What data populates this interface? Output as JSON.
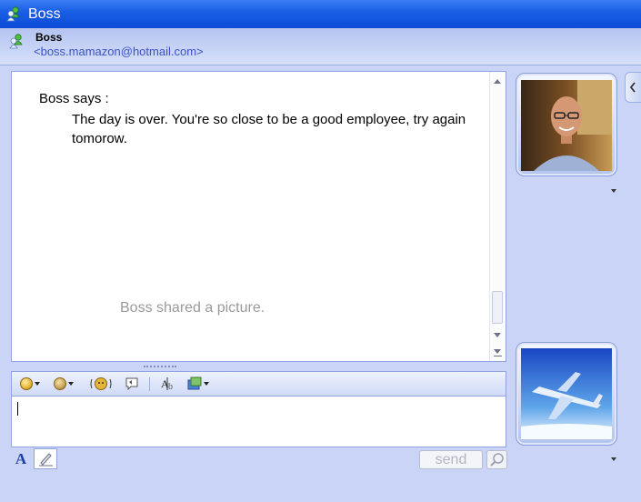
{
  "window": {
    "title": "Boss"
  },
  "contact": {
    "name": "Boss",
    "email": "<boss.mamazon@hotmail.com>"
  },
  "conversation": {
    "sender_line": "Boss says :",
    "message": "The day is over. You're so close to be a good employee, try again tomorow.",
    "notice": "Boss shared a picture."
  },
  "compose": {
    "send_label": "send",
    "font_button_label": "A"
  },
  "colors": {
    "titlebar": "#1a5fe6",
    "frame": "#c9d4f6",
    "email": "#3e52c6"
  }
}
